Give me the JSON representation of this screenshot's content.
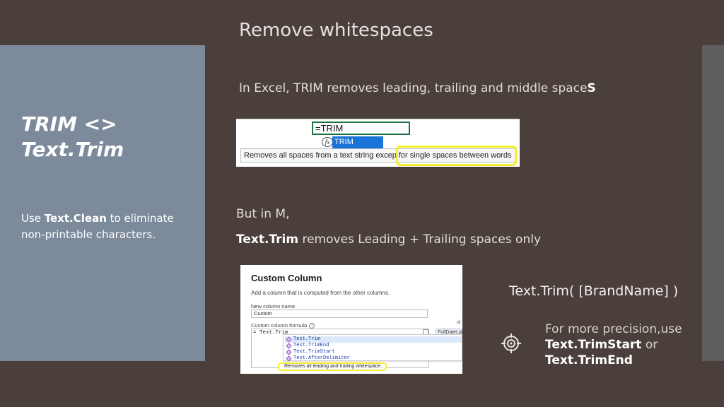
{
  "slide": {
    "title": "Remove whitespaces"
  },
  "left_panel": {
    "title_line1": "TRIM <>",
    "title_line2": "Text.Trim",
    "note_pre": "Use ",
    "note_bold": "Text.Clean",
    "note_post": " to eliminate non-printable characters."
  },
  "excel": {
    "description_pre": "In Excel, TRIM removes leading, trailing and middle space",
    "description_bold": "S",
    "cell_formula": "=TRIM",
    "fx_glyph": "fx",
    "dropdown_item": "TRIM",
    "tooltip": "Removes all spaces from a text string excep",
    "tooltip_highlight": "for single spaces between words"
  },
  "m_section": {
    "intro": "But in M,",
    "func_bold": "Text.Trim",
    "func_rest": " removes Leading + Trailing spaces only"
  },
  "power_query": {
    "dialog_title": "Custom Column",
    "subtitle": "Add a column that is computed from the other columns.",
    "name_label": "New column name",
    "name_value": "Custom",
    "formula_label": "Custom column formula",
    "info_glyph": "i",
    "formula_value": "= Text.Trim",
    "side_header": "ol",
    "side_label": "FullDateLabel",
    "suggestions": [
      "Text.Trim",
      "Text.TrimEnd",
      "Text.TrimStart",
      "Text.AfterDelimiter"
    ],
    "tooltip": "Removes all leading and trailing whitespace."
  },
  "formula_example": "Text.Trim( [BrandName] )",
  "precision": {
    "pre": "For more precision,use ",
    "bold1": "Text.TrimStart",
    "mid": " or ",
    "bold2": "Text.TrimEnd"
  },
  "colors": {
    "background": "#4a3f3b",
    "left_panel": "#7d8a9c",
    "right_strip": "#5e5e5e",
    "highlight": "#f2ee2c",
    "excel_green": "#1e7145",
    "excel_blue": "#1a73d9"
  },
  "icons": {
    "target": "target-icon",
    "function": "fx-icon",
    "cube": "function-cube-icon"
  }
}
